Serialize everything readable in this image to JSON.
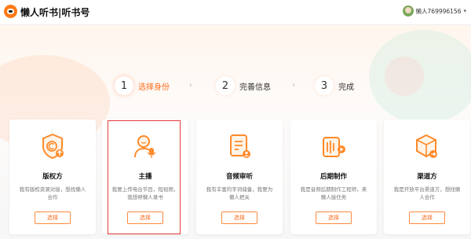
{
  "header": {
    "brand": "懒人听书|听书号",
    "username": "懒人769996156",
    "caret": "▾"
  },
  "steps": [
    {
      "number": "1",
      "label": "选择身份",
      "active": true
    },
    {
      "number": "2",
      "label": "完善信息",
      "active": false
    },
    {
      "number": "3",
      "label": "完成",
      "active": false
    }
  ],
  "step_separator": "›",
  "roles": [
    {
      "title": "版权方",
      "desc": "我有版权资源对接，想找懒人合作",
      "button": "选择",
      "icon": "copyright-upload-icon"
    },
    {
      "title": "主播",
      "desc": "我要上传电台节目，短视频，我想帮懒人录书",
      "button": "选择",
      "icon": "host-microphone-icon"
    },
    {
      "title": "音频审听",
      "desc": "我有丰富的字词储备，我要为懒人把关",
      "button": "选择",
      "icon": "audio-review-icon"
    },
    {
      "title": "后期制作",
      "desc": "我是音频后期制作工程师，来懒人接任务",
      "button": "选择",
      "icon": "post-production-icon"
    },
    {
      "title": "渠道方",
      "desc": "我是开放平台渠道方，想找懒人合作",
      "button": "选择",
      "icon": "channel-cube-icon"
    }
  ],
  "colors": {
    "accent": "#ff6a1a",
    "icon_primary": "#ff8a2a",
    "icon_secondary": "#ffd7b0",
    "highlight_border": "#e53b3b"
  }
}
